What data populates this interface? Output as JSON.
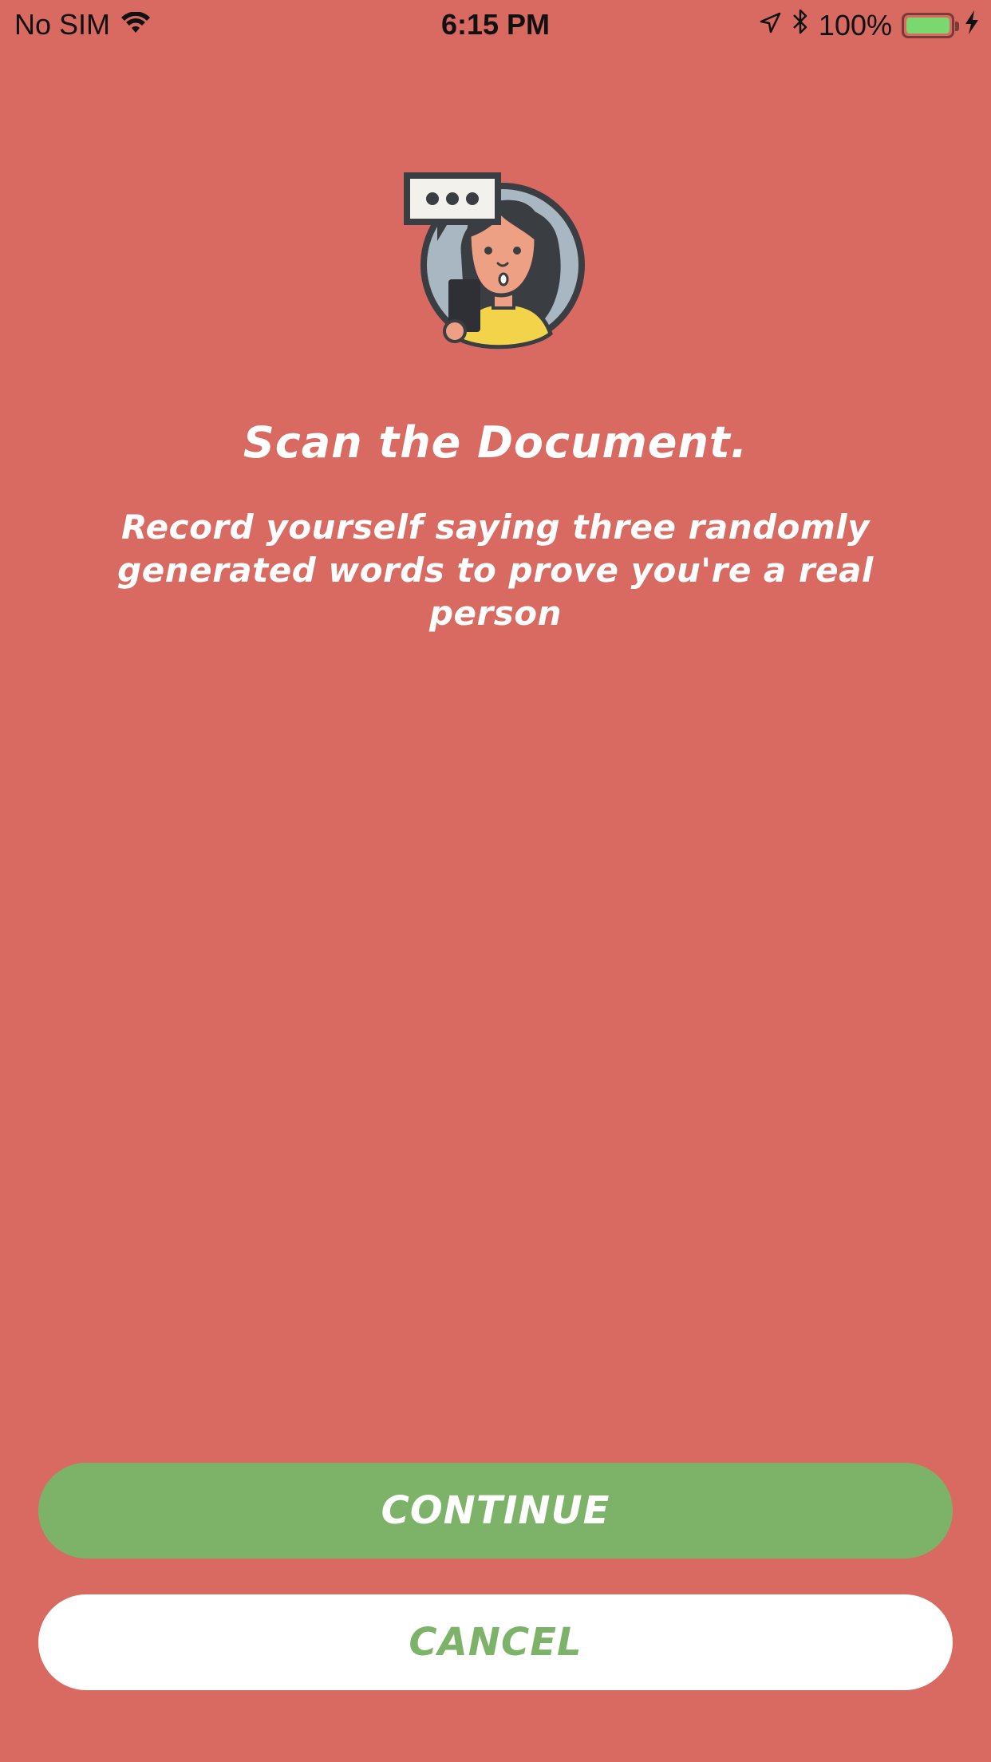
{
  "status_bar": {
    "carrier": "No SIM",
    "time": "6:15 PM",
    "battery_percent": "100%",
    "battery_level": 1.0,
    "icons": [
      "wifi-icon",
      "location-arrow-icon",
      "bluetooth-icon",
      "battery-icon",
      "charging-bolt-icon"
    ]
  },
  "main": {
    "illustration": "person-with-speech-bubble-illustration",
    "title": "Scan the Document.",
    "subtitle": "Record yourself saying three randomly generated words to prove you're a real person"
  },
  "actions": {
    "continue_label": "CONTINUE",
    "cancel_label": "CANCEL"
  },
  "colors": {
    "background": "#d86a62",
    "primary_button": "#7db369",
    "secondary_button": "#ffffff",
    "text": "#ffffff"
  }
}
